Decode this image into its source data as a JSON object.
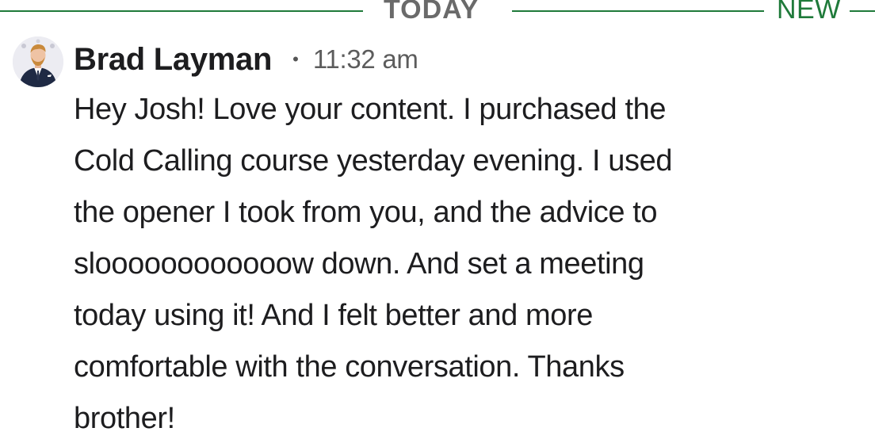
{
  "divider": {
    "today_label": "TODAY",
    "new_label": "NEW"
  },
  "colors": {
    "accent_green": "#1f7a3a",
    "label_gray": "#6a6a6a",
    "text": "#1d1d1f"
  },
  "message": {
    "sender": "Brad Layman",
    "separator": "•",
    "time": "11:32 am",
    "avatar_icon": "profile-photo",
    "lines": [
      "Hey Josh! Love your content. I purchased the",
      "Cold Calling course yesterday evening. I used",
      "the opener I took from you, and the advice to",
      "sloooooooooooow down. And set a meeting",
      "today using it! And I felt better and more",
      "comfortable with the conversation. Thanks",
      "brother!"
    ]
  }
}
